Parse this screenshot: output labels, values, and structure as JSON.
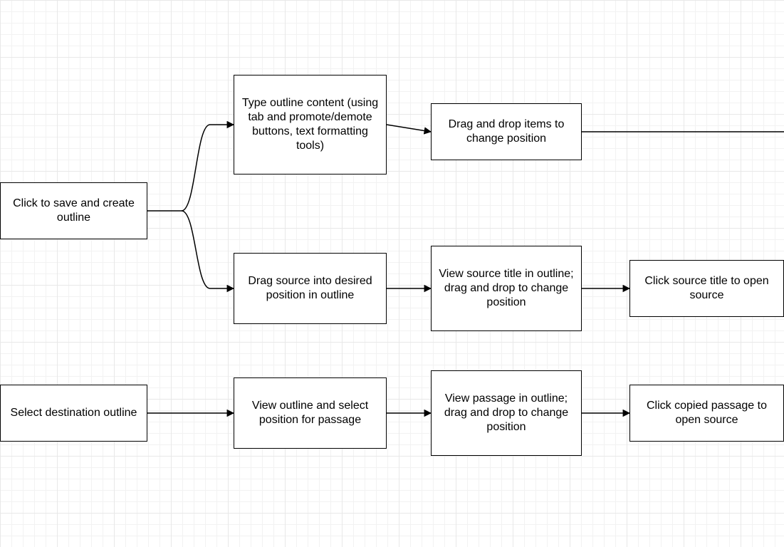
{
  "diagram": {
    "boxes": {
      "save_create": "Click to save and create outline",
      "type_content": "Type outline content (using tab and promote/demote buttons, text formatting tools)",
      "drag_items": "Drag and drop items to change position",
      "drag_source": "Drag source into desired position in outline",
      "view_source_title": "View source title in outline; drag and drop to change position",
      "click_source_title": "Click source title to open source",
      "select_dest": "Select destination outline",
      "view_outline_select": "View outline and select position for passage",
      "view_passage": "View passage in outline; drag and drop to change position",
      "click_copied": "Click copied passage to open source"
    }
  }
}
